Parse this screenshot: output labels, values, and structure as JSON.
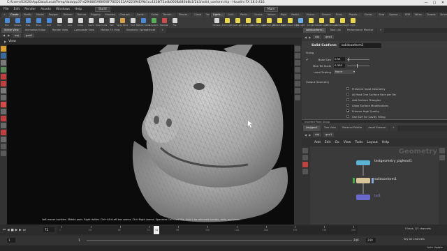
{
  "window": {
    "title": "C:/Users/02020/AppData/Local/Temp/data/pp37r42948859f8f6f8F70ED1E3AA22394E/9b1cc4328f72adb060fb846b8b1f2b3/solid_conform.hip - Houdini FX 18.0.416",
    "controls": [
      "—",
      "□",
      "✕"
    ]
  },
  "menubar": {
    "items": [
      "File",
      "Edit",
      "Render",
      "Assets",
      "Windows",
      "Help"
    ],
    "build_label": "Build",
    "main_label": "Main"
  },
  "shelf": {
    "left_tabs": [
      "+",
      "Create",
      "Modify",
      "Model",
      "Polygon",
      "Deform",
      "Texture",
      "Rigging",
      "Muscles",
      "Charact…",
      "Const…",
      "Guide P…",
      "Terrain…",
      "Simple…",
      "Cloud FX",
      "Volume"
    ],
    "right_tabs": [
      "Lights…",
      "Colli…",
      "Partic…",
      "Grains",
      "Vellum",
      "Rigid B…",
      "Particl…",
      "Viscou…",
      "Oceans",
      "Fluid…",
      "Popula…",
      "Conta…",
      "Pyro FX",
      "Sparse…",
      "FEM",
      "Wires",
      "Crowds",
      "Drive…"
    ],
    "left_tools": [
      {
        "label": "Box",
        "color": "#4a8ad8"
      },
      {
        "label": "Sphere",
        "color": "#4a8ad8"
      },
      {
        "label": "Tube",
        "color": "#4a8ad8"
      },
      {
        "label": "Torus",
        "color": "#4a8ad8"
      },
      {
        "label": "Grid",
        "color": "#4a8ad8"
      },
      {
        "label": "Null",
        "color": "#d8d8d8"
      },
      {
        "label": "Line",
        "color": "#d8d8d8"
      },
      {
        "label": "Circle",
        "color": "#d8d8d8"
      },
      {
        "label": "Curve",
        "color": "#d8d8d8"
      },
      {
        "label": "Draw Curve",
        "color": "#d8d8d8"
      },
      {
        "label": "Path",
        "color": "#d8d8d8"
      },
      {
        "label": "Spray Paint",
        "color": "#d8a24a"
      },
      {
        "label": "Font",
        "color": "#d8d8d8"
      },
      {
        "label": "Platonic Solids",
        "color": "#4a8ad8"
      },
      {
        "label": "L-System",
        "color": "#5ab05a"
      },
      {
        "label": "Metaball",
        "color": "#d04a4a"
      },
      {
        "label": "File",
        "color": "#d8d8d8"
      }
    ],
    "right_tools": [
      {
        "label": "Camera",
        "color": "#d8d8d8"
      },
      {
        "label": "Point Light",
        "color": "#e8d84a"
      },
      {
        "label": "Spot Light",
        "color": "#e8d84a"
      },
      {
        "label": "Area Light",
        "color": "#e8d84a"
      },
      {
        "label": "Geometry Light",
        "color": "#e8d84a"
      },
      {
        "label": "Volume Light",
        "color": "#e8d84a"
      },
      {
        "label": "Distant Light",
        "color": "#e8d84a"
      },
      {
        "label": "Environment Light",
        "color": "#e8d84a"
      },
      {
        "label": "Sky Light",
        "color": "#6ab0e8"
      },
      {
        "label": "GI Light",
        "color": "#e8d84a"
      },
      {
        "label": "Caustic Light",
        "color": "#e8d84a"
      },
      {
        "label": "Portal Light",
        "color": "#e8d84a"
      },
      {
        "label": "Ambient Light",
        "color": "#e8d84a"
      },
      {
        "label": "Light",
        "color": "#e8d84a"
      }
    ]
  },
  "viewer": {
    "tabs": [
      "Scene View",
      "Animation Editor",
      "Render View",
      "Composite View",
      "Motion FX View",
      "Geometry Spreadsheet",
      "+"
    ],
    "path": [
      "obj",
      "geo1"
    ],
    "view_label": "View",
    "status_hint": "Left mouse tumbles. Middle pans. Right dollies. Ctrl+Alt+Left box zooms. Ctrl+Right zooms. Spacebar Ctrl+Left tilts. Hold L for alternate tumble, dolly, and zoom."
  },
  "params": {
    "tabs": [
      "solidconform1",
      "Take List",
      "Performance Monitor",
      "+"
    ],
    "path": [
      "obj",
      "geo1"
    ],
    "node_type": "Solid Conform",
    "node_name": "solidconform1",
    "sizing_label": "Sizing",
    "base_size": {
      "label": "Base Size",
      "value": "0.53",
      "fraction": 0.05
    },
    "max_tet_scale": {
      "label": "Max Tet Scale",
      "value": "0.300",
      "fraction": 0.45
    },
    "local_scaling": {
      "label": "Local Scaling",
      "value": "None"
    },
    "output_geometry_label": "Output Geometry",
    "options": [
      {
        "label": "Preserve Input Geometry",
        "checked": ""
      },
      {
        "label": "At Most One Surface Face per Tet",
        "checked": ""
      },
      {
        "label": "Add Surface Triangles",
        "checked": ""
      },
      {
        "label": "Allow Surface Modifications",
        "checked": ""
      },
      {
        "label": "Enforce High Quality",
        "checked": "✔"
      },
      {
        "label": "Use SDF for Cavity Filling",
        "checked": ""
      }
    ],
    "collapsed_section": "Inverted Point Group"
  },
  "network": {
    "tabs": [
      "/obj/geo1",
      "Tree View",
      "Material Palette",
      "Asset Browser",
      "+"
    ],
    "path": [
      "obj",
      "geo1"
    ],
    "menu": [
      "Add",
      "Edit",
      "Go",
      "View",
      "Tools",
      "Layout",
      "Help"
    ],
    "watermark": "Geometry",
    "nodes": [
      {
        "name": "testgeometry_pighead1",
        "color": "#59b4d4"
      },
      {
        "name": "solidconform1",
        "color": "#d8c59a"
      },
      {
        "name": "tet1",
        "color": "#6a6acc"
      }
    ]
  },
  "timeline": {
    "current_frame": "72",
    "start_frame": "1",
    "start_frame_b": "1",
    "end_frame": "240",
    "end_frame_b": "240",
    "ticks": [
      "1",
      "24",
      "48",
      "72",
      "96",
      "120",
      "144",
      "168",
      "192",
      "216",
      "240"
    ],
    "keys_label": "0 keys, 1/1 channels",
    "channels_label": "Key All Channels",
    "auto_update": "Auto Update"
  }
}
